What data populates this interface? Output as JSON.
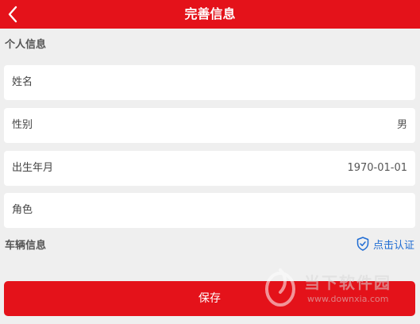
{
  "header": {
    "title": "完善信息"
  },
  "personal_section": {
    "title": "个人信息"
  },
  "fields": [
    {
      "label": "姓名",
      "value": ""
    },
    {
      "label": "性别",
      "value": "男"
    },
    {
      "label": "出生年月",
      "value": "1970-01-01"
    },
    {
      "label": "角色",
      "value": ""
    }
  ],
  "vehicle_section": {
    "title": "车辆信息",
    "verify_label": "点击认证"
  },
  "save_button": {
    "label": "保存"
  },
  "watermark": {
    "cn": "当下软件园",
    "url": "www.downxia.com"
  },
  "colors": {
    "brand_red": "#e4121a",
    "link_blue": "#1f6cd3",
    "background": "#efefef"
  },
  "icons": {
    "back": "chevron-left-icon",
    "verify": "shield-check-icon"
  }
}
